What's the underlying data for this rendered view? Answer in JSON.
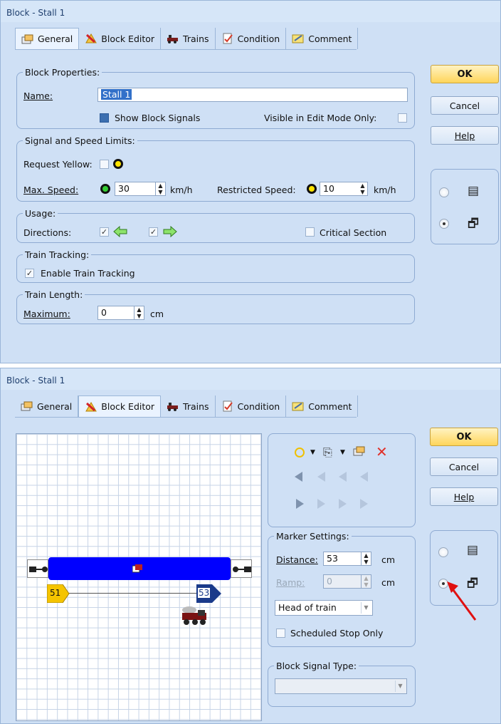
{
  "window1": {
    "title": "Block - Stall 1",
    "tabs": [
      {
        "label": "General",
        "icon": "general-icon"
      },
      {
        "label": "Block Editor",
        "icon": "block-editor-icon"
      },
      {
        "label": "Trains",
        "icon": "trains-icon"
      },
      {
        "label": "Condition",
        "icon": "condition-icon"
      },
      {
        "label": "Comment",
        "icon": "comment-icon"
      }
    ],
    "active_tab": "General",
    "block_properties": {
      "legend": "Block Properties:",
      "name_label": "Name:",
      "name_value": "Stall 1",
      "show_block_signals": "Show Block Signals",
      "visible_in_edit_mode": "Visible in Edit Mode Only:"
    },
    "signal_speed": {
      "legend": "Signal and Speed Limits:",
      "request_yellow": "Request Yellow:",
      "max_speed_label": "Max. Speed:",
      "max_speed_value": "30",
      "max_speed_unit": "km/h",
      "restricted_label": "Restricted Speed:",
      "restricted_value": "10",
      "restricted_unit": "km/h"
    },
    "usage": {
      "legend": "Usage:",
      "directions_label": "Directions:",
      "critical_section": "Critical Section"
    },
    "train_tracking": {
      "legend": "Train Tracking:",
      "enable": "Enable Train Tracking"
    },
    "train_length": {
      "legend": "Train Length:",
      "maximum_label": "Maximum:",
      "maximum_value": "0",
      "unit": "cm"
    },
    "buttons": {
      "ok": "OK",
      "cancel": "Cancel",
      "help": "Help"
    }
  },
  "window2": {
    "title": "Block - Stall 1",
    "tabs": [
      {
        "label": "General",
        "icon": "general-icon"
      },
      {
        "label": "Block Editor",
        "icon": "block-editor-icon"
      },
      {
        "label": "Trains",
        "icon": "trains-icon"
      },
      {
        "label": "Condition",
        "icon": "condition-icon"
      },
      {
        "label": "Comment",
        "icon": "comment-icon"
      }
    ],
    "active_tab": "Block Editor",
    "editor": {
      "marker_left": "51",
      "marker_right": "53"
    },
    "marker_settings": {
      "legend": "Marker Settings:",
      "distance_label": "Distance:",
      "distance_value": "53",
      "distance_unit": "cm",
      "ramp_label": "Ramp:",
      "ramp_value": "0",
      "ramp_unit": "cm",
      "position_select": "Head of train",
      "scheduled_stop": "Scheduled Stop Only"
    },
    "block_signal_type": {
      "legend": "Block Signal Type:",
      "value": ""
    },
    "buttons": {
      "ok": "OK",
      "cancel": "Cancel",
      "help": "Help"
    }
  },
  "colors": {
    "dialog_bg": "#cfe0f5",
    "ok_button": "#ffd55a",
    "block_fill": "#0000ff",
    "marker_left": "#f5c400",
    "marker_right": "#1a3a8a",
    "annotation_arrow": "#e01010",
    "delete_x": "#e0312a"
  }
}
